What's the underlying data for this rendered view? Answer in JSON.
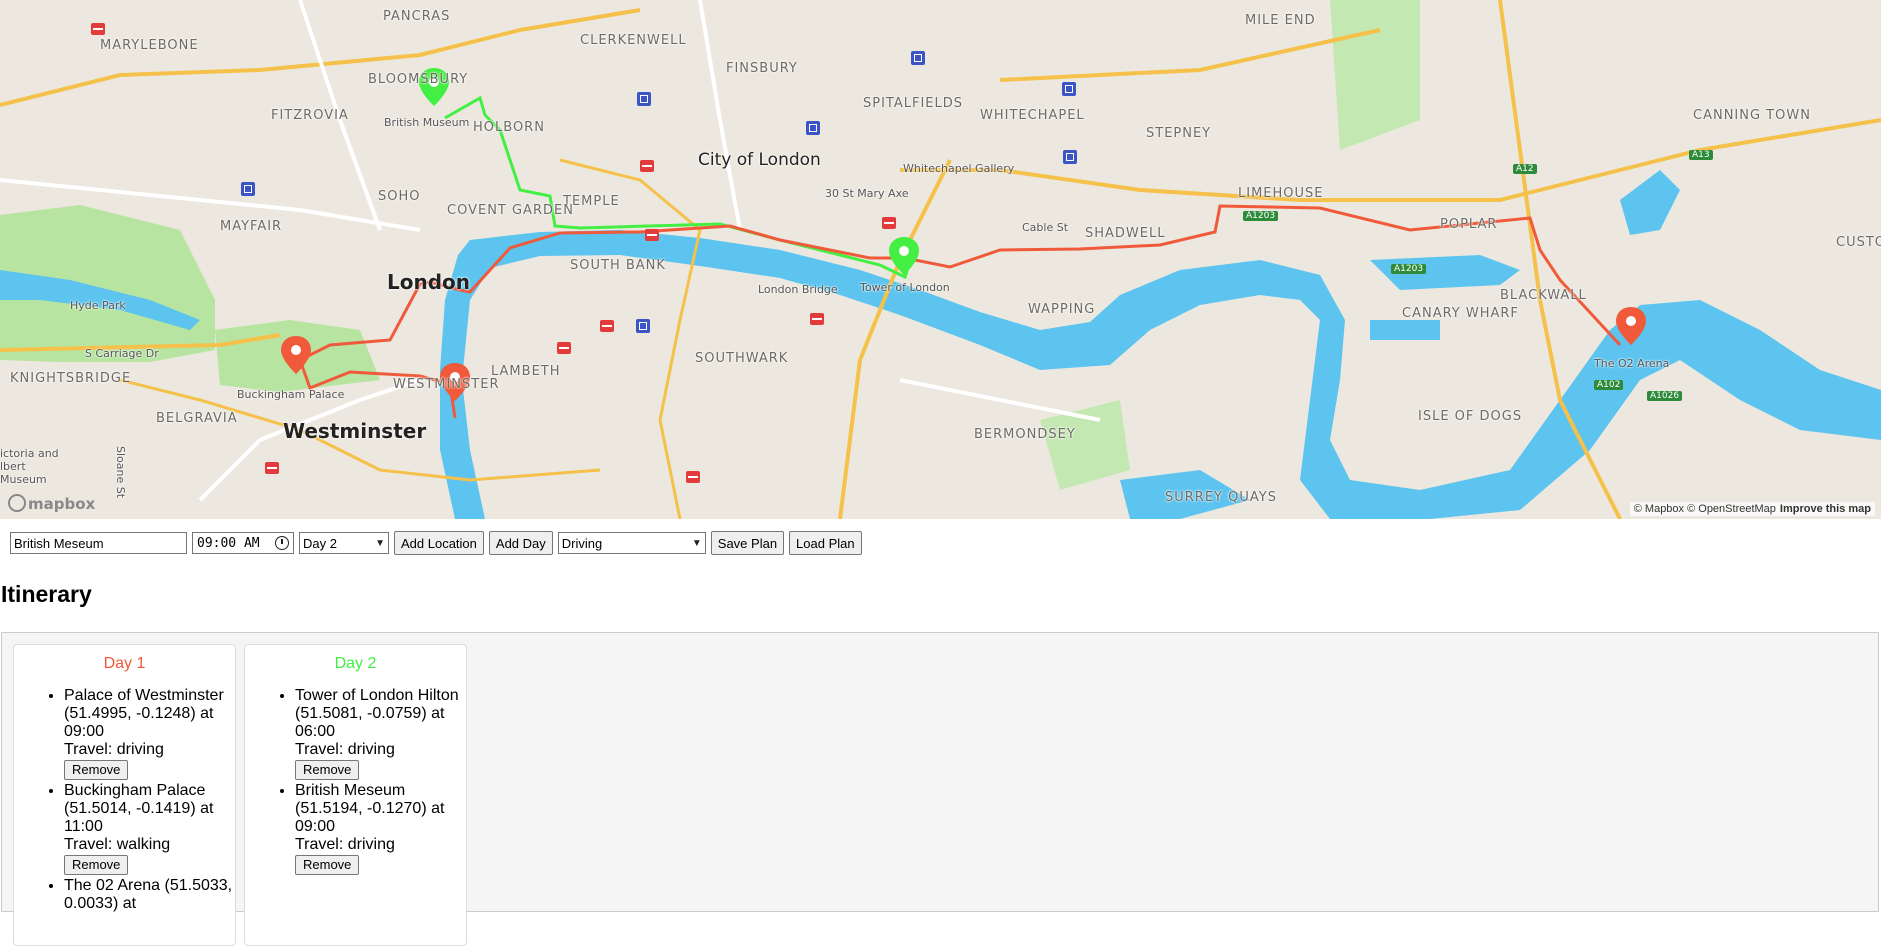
{
  "map": {
    "colors": {
      "land": "#ece8df",
      "water": "#5cc4ef",
      "park": "#b7e4a0",
      "road_major": "#f5c14a",
      "route_day1": "#f05a3a",
      "route_day2": "#42ef42",
      "marker_day1": "#f05a3a",
      "marker_day2": "#42ef42"
    },
    "areas": [
      "PANCRAS",
      "MARYLEBONE",
      "CLERKENWELL",
      "MILE END",
      "BLOOMSBURY",
      "FINSBURY",
      "SPITALFIELDS",
      "FITZROVIA",
      "HOLBORN",
      "WHITECHAPEL",
      "STEPNEY",
      "CANNING TOWN",
      "City of London",
      "TEMPLE",
      "SOHO",
      "COVENT GARDEN",
      "MAYFAIR",
      "LIMEHOUSE",
      "POPLAR",
      "SHADWELL",
      "CUSTOM HOUSE",
      "SOUTH BANK",
      "London",
      "WAPPING",
      "BLACKWALL",
      "CANARY WHARF",
      "KNIGHTSBRIDGE",
      "LAMBETH",
      "SOUTHWARK",
      "WESTMINSTER",
      "BELGRAVIA",
      "Westminster",
      "BERMONDSEY",
      "ISLE OF DOGS",
      "SURREY QUAYS"
    ],
    "pois": [
      "British Museum",
      "Whitechapel Gallery",
      "30 St Mary Axe",
      "Cable St",
      "London Bridge",
      "Tower of London",
      "Hyde Park",
      "S Carriage Dr",
      "Buckingham Palace",
      "The O2 Arena",
      "Sloane St",
      "ictoria and lbert Museum"
    ],
    "road_tags": [
      "A1203",
      "A12",
      "A13",
      "A1203",
      "A102",
      "A1026"
    ],
    "logo": "mapbox",
    "attribution": "© Mapbox © OpenStreetMap",
    "improve": "Improve this map"
  },
  "controls": {
    "location_value": "British Meseum",
    "time_value": "09:00 AM",
    "day_select": "Day 2",
    "add_location": "Add Location",
    "add_day": "Add Day",
    "mode_select": "Driving",
    "save_plan": "Save Plan",
    "load_plan": "Load Plan"
  },
  "itinerary": {
    "heading": "Itinerary",
    "days": [
      {
        "title": "Day 1",
        "color": "#f05a3a",
        "stops": [
          {
            "line": "Palace of Westminster (51.4995, -0.1248) at 09:00",
            "travel": "Travel: driving",
            "remove": "Remove"
          },
          {
            "line": "Buckingham Palace (51.5014, -0.1419) at 11:00",
            "travel": "Travel: walking",
            "remove": "Remove"
          },
          {
            "line": "The 02 Arena (51.5033, 0.0033) at",
            "travel": "",
            "remove": ""
          }
        ]
      },
      {
        "title": "Day 2",
        "color": "#42ef42",
        "stops": [
          {
            "line": "Tower of London Hilton (51.5081, -0.0759) at 06:00",
            "travel": "Travel: driving",
            "remove": "Remove"
          },
          {
            "line": "British Meseum (51.5194, -0.1270) at 09:00",
            "travel": "Travel: driving",
            "remove": "Remove"
          }
        ]
      }
    ]
  }
}
